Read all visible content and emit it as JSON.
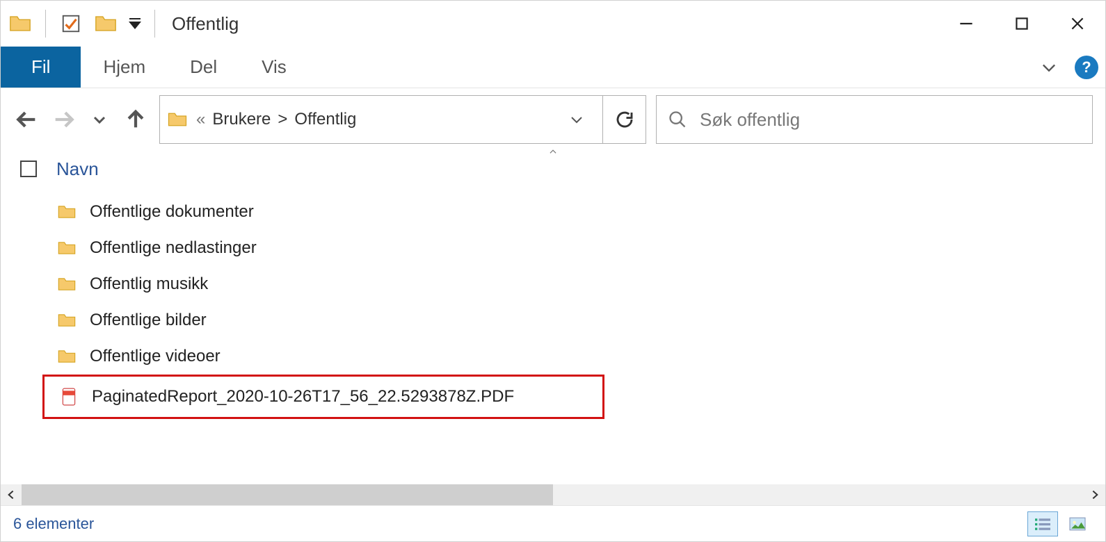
{
  "title": "Offentlig",
  "ribbon": {
    "file_label": "Fil",
    "home_label": "Hjem",
    "share_label": "Del",
    "view_label": "Vis"
  },
  "breadcrumbs": {
    "prefix": "«",
    "parent": "Brukere",
    "sep": ">",
    "current": "Offentlig"
  },
  "search": {
    "placeholder": "Søk offentlig"
  },
  "columns": {
    "name": "Navn"
  },
  "items": [
    {
      "type": "folder",
      "name": "Offentlige dokumenter"
    },
    {
      "type": "folder",
      "name": "Offentlige nedlastinger"
    },
    {
      "type": "folder",
      "name": "Offentlig musikk"
    },
    {
      "type": "folder",
      "name": "Offentlige bilder"
    },
    {
      "type": "folder",
      "name": "Offentlige videoer"
    },
    {
      "type": "pdf",
      "name": "PaginatedReport_2020-10-26T17_56_22.5293878Z.PDF",
      "highlighted": true
    }
  ],
  "status": {
    "text": "6 elementer"
  }
}
